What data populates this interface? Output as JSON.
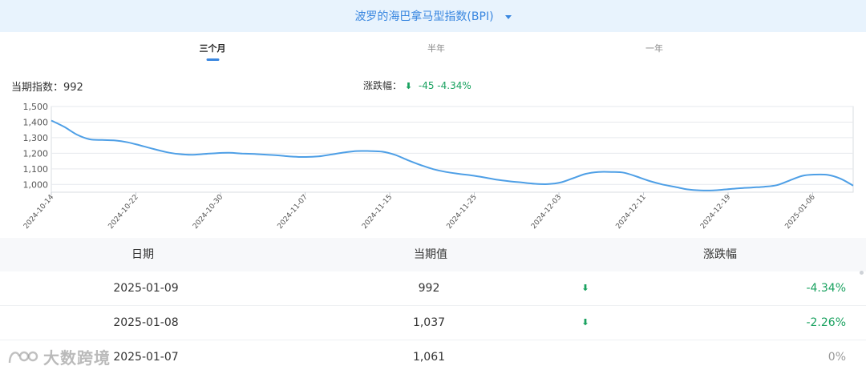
{
  "header": {
    "title": "波罗的海巴拿马型指数(BPI)"
  },
  "tabs": [
    {
      "label": "三个月",
      "active": true
    },
    {
      "label": "半年",
      "active": false
    },
    {
      "label": "一年",
      "active": false
    }
  ],
  "summary": {
    "current_label": "当期指数：992",
    "change_label": "涨跌幅：",
    "change_value": "-45  -4.34%"
  },
  "colors": {
    "accent": "#3a87e0",
    "down": "#1aa260",
    "line": "#4e9fe6"
  },
  "chart_data": {
    "type": "line",
    "ylim": [
      950,
      1500
    ],
    "yticks": [
      1000,
      1100,
      1200,
      1300,
      1400,
      1500
    ],
    "ytick_labels": [
      "1,000",
      "1,100",
      "1,200",
      "1,300",
      "1,400",
      "1,500"
    ],
    "xtick_labels": [
      "2024-10-14",
      "2024-10-22",
      "2024-10-30",
      "2024-11-07",
      "2024-11-15",
      "2024-11-25",
      "2024-12-03",
      "2024-12-11",
      "2024-12-19",
      "2025-01-06"
    ],
    "grid": true,
    "series": [
      {
        "values": [
          1410,
          1370,
          1320,
          1290,
          1285,
          1282,
          1270,
          1250,
          1228,
          1208,
          1195,
          1190,
          1195,
          1201,
          1203,
          1198,
          1195,
          1190,
          1185,
          1178,
          1176,
          1180,
          1192,
          1205,
          1214,
          1214,
          1210,
          1190,
          1156,
          1125,
          1098,
          1080,
          1068,
          1058,
          1045,
          1030,
          1020,
          1012,
          1004,
          1002,
          1012,
          1040,
          1068,
          1080,
          1080,
          1075,
          1050,
          1022,
          1000,
          984,
          968,
          962,
          962,
          968,
          975,
          980,
          985,
          995,
          1025,
          1055,
          1063,
          1061,
          1037,
          992
        ]
      }
    ]
  },
  "table": {
    "headers": [
      "日期",
      "当期值",
      "涨跌幅"
    ],
    "rows": [
      {
        "date": "2025-01-09",
        "value": "992",
        "arrow": "down-arrow-icon",
        "pct": "-4.34%"
      },
      {
        "date": "2025-01-08",
        "value": "1,037",
        "arrow": "down-arrow-icon",
        "pct": "-2.26%"
      },
      {
        "date": "2025-01-07",
        "value": "1,061",
        "arrow": "",
        "pct": "0%"
      }
    ]
  },
  "watermark": {
    "text": "大数跨境"
  }
}
